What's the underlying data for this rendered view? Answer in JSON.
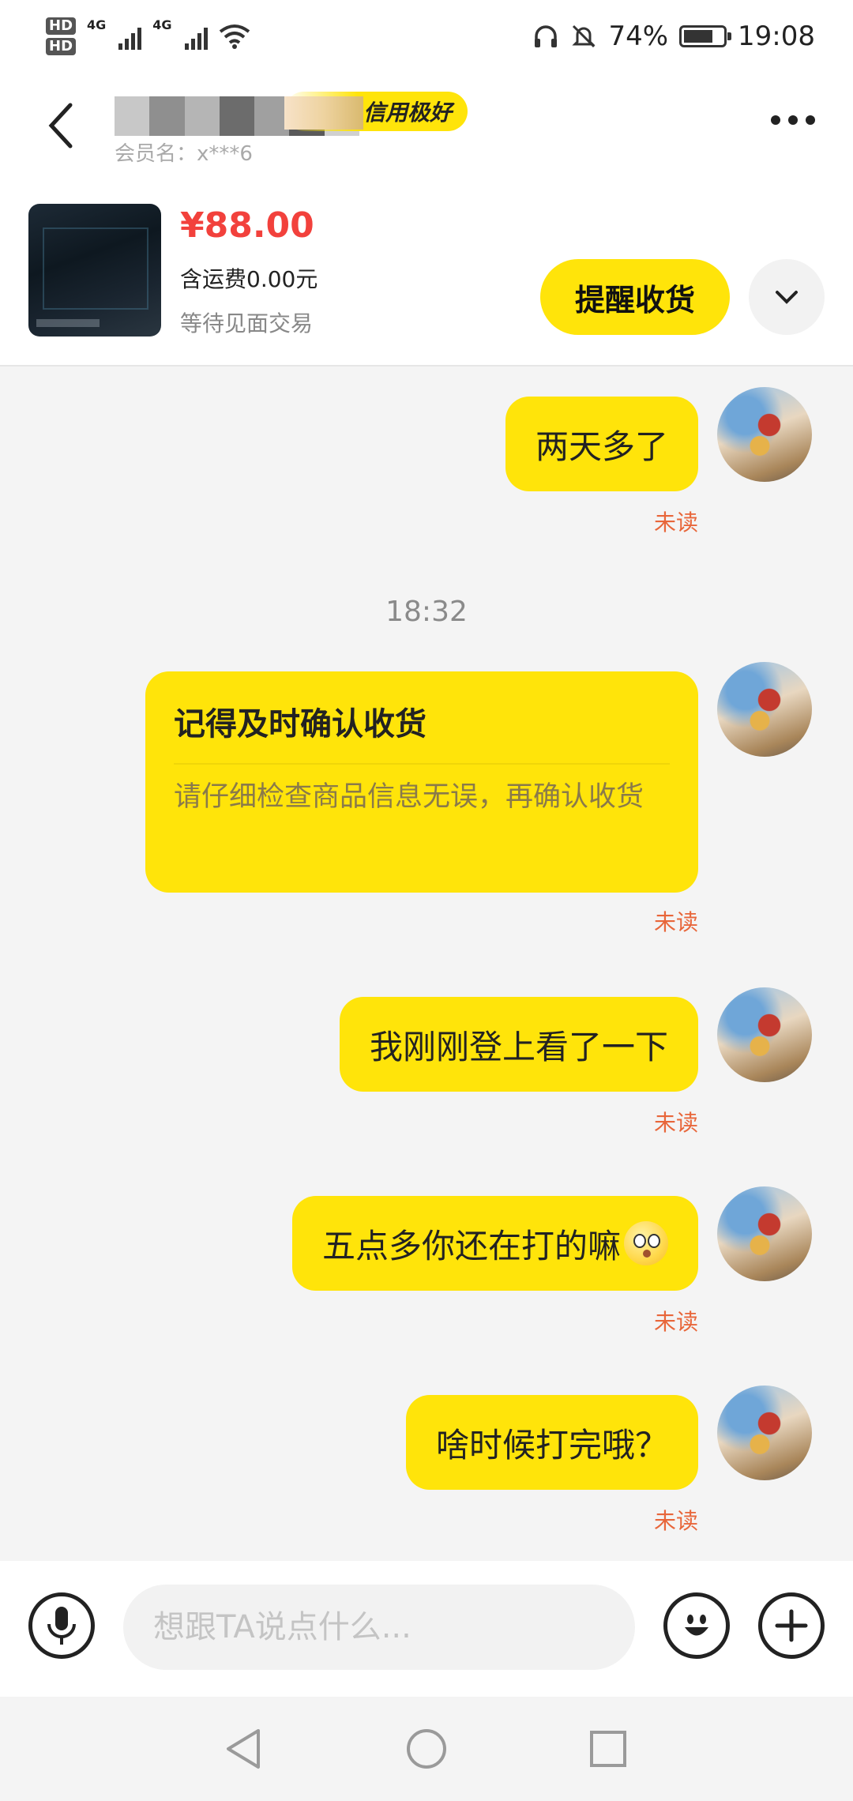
{
  "status_bar": {
    "hd1": "HD",
    "hd2": "HD",
    "net1": "4G",
    "net2": "4G",
    "battery_percent": "74%",
    "time": "19:08"
  },
  "header": {
    "credit_badge": "信用极好",
    "member_name": "会员名：x***6"
  },
  "product": {
    "price": "¥88.00",
    "shipping": "含运费0.00元",
    "status": "等待见面交易",
    "remind_button": "提醒收货"
  },
  "messages": [
    {
      "text": "两天多了",
      "status": "未读"
    },
    {
      "time": "18:32"
    },
    {
      "card_title": "记得及时确认收货",
      "card_body": "请仔细检查商品信息无误，再确认收货",
      "status": "未读"
    },
    {
      "text": "我刚刚登上看了一下",
      "status": "未读"
    },
    {
      "text": "五点多你还在打的嘛",
      "emoji": "thinking-face-emoji",
      "status": "未读"
    },
    {
      "text": "啥时候打完哦？",
      "status": "未读"
    }
  ],
  "input": {
    "placeholder": "想跟TA说点什么..."
  },
  "icons": {
    "back": "chevron-left-icon",
    "more": "more-dots-icon",
    "expand": "chevron-down-icon",
    "voice": "microphone-icon",
    "emoji": "smiley-icon",
    "add": "plus-icon",
    "nav_back": "triangle-back-icon",
    "nav_home": "circle-home-icon",
    "nav_recent": "square-recent-icon"
  },
  "colors": {
    "accent": "#ffe40a",
    "price": "#f2413c",
    "unread": "#e8663a"
  }
}
